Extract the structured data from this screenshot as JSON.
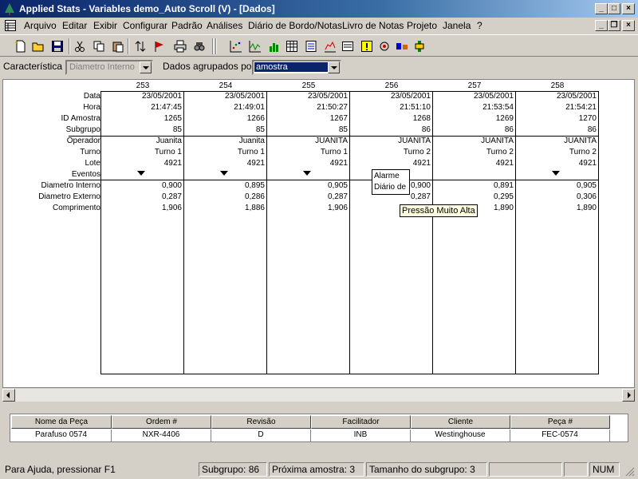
{
  "window": {
    "title": "Applied Stats - Variables demo_Auto Scroll (V) - [Dados]"
  },
  "menu": [
    "Arquivo",
    "Editar",
    "Exibir",
    "Configurar",
    "Padrão",
    "Análises",
    "Diário de Bordo/Notas",
    "Livro de Notas",
    "Projeto",
    "Janela",
    "?"
  ],
  "filters": {
    "caracteristica_label": "Característica",
    "caracteristica_value": "Diametro Interno",
    "agrupados_label": "Dados agrupados por",
    "agrupados_value": "amostra"
  },
  "grid": {
    "row_labels": [
      "Data",
      "Hora",
      "ID Amostra",
      "Subgrupo",
      "Operador",
      "Turno",
      "Lote",
      "Eventos",
      "Diametro Interno",
      "Diametro Externo",
      "Comprimento"
    ],
    "columns": [
      {
        "num": "253",
        "data": "23/05/2001",
        "hora": "21:47:45",
        "id": "1265",
        "subgrupo": "85",
        "operador": "Juanita",
        "turno": "Turno 1",
        "lote": "4921",
        "di": "0,900",
        "de": "0,287",
        "comp": "1,906"
      },
      {
        "num": "254",
        "data": "23/05/2001",
        "hora": "21:49:01",
        "id": "1266",
        "subgrupo": "85",
        "operador": "Juanita",
        "turno": "Turno 1",
        "lote": "4921",
        "di": "0,895",
        "de": "0,286",
        "comp": "1,886"
      },
      {
        "num": "255",
        "data": "23/05/2001",
        "hora": "21:50:27",
        "id": "1267",
        "subgrupo": "85",
        "operador": "JUANITA",
        "turno": "Turno 1",
        "lote": "4921",
        "di": "0,905",
        "de": "0,287",
        "comp": "1,906"
      },
      {
        "num": "256",
        "data": "23/05/2001",
        "hora": "21:51:10",
        "id": "1268",
        "subgrupo": "86",
        "operador": "JUANITA",
        "turno": "Turno 2",
        "lote": "4921",
        "di": "0,900",
        "de": "0,287",
        "comp": ""
      },
      {
        "num": "257",
        "data": "23/05/2001",
        "hora": "21:53:54",
        "id": "1269",
        "subgrupo": "86",
        "operador": "JUANITA",
        "turno": "Turno 2",
        "lote": "4921",
        "di": "0,891",
        "de": "0,295",
        "comp": "1,890"
      },
      {
        "num": "258",
        "data": "23/05/2001",
        "hora": "21:54:21",
        "id": "1270",
        "subgrupo": "86",
        "operador": "JUANITA",
        "turno": "Turno 2",
        "lote": "4921",
        "di": "0,905",
        "de": "0,306",
        "comp": "1,890"
      }
    ],
    "event_popup": [
      "Alarme",
      "Diário de"
    ],
    "tooltip": "Pressão Muito Alta"
  },
  "info": {
    "headers": [
      "Nome da Peça",
      "Ordem #",
      "Revisão",
      "Facilitador",
      "Cliente",
      "Peça #"
    ],
    "values": [
      "Parafuso 0574",
      "NXR-4406",
      "D",
      "INB",
      "Westinghouse",
      "FEC-0574"
    ]
  },
  "status": {
    "help": "Para Ajuda, pressionar F1",
    "subgrupo": "Subgrupo: 86",
    "proxima": "Próxima amostra: 3",
    "tamanho": "Tamanho do subgrupo: 3",
    "num": "NUM"
  }
}
